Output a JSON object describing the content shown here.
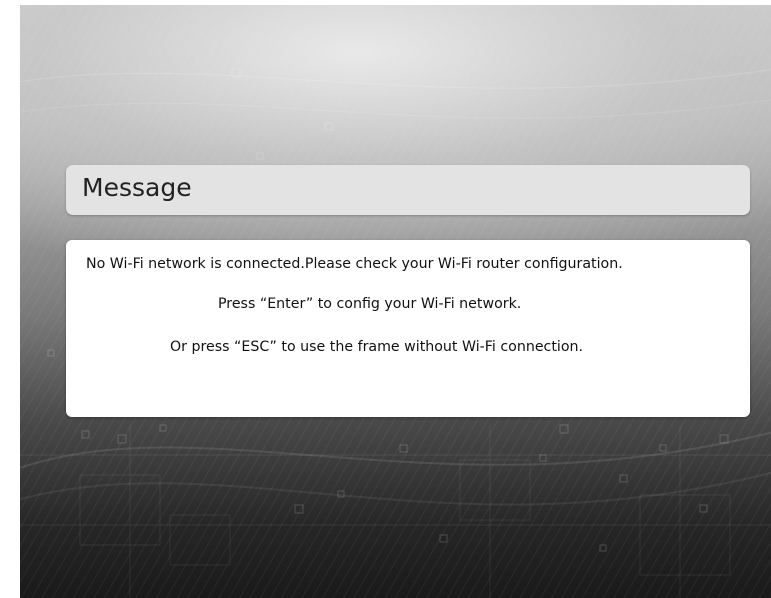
{
  "dialog": {
    "title": "Message",
    "lines": [
      "No Wi-Fi network is connected.Please check your Wi-Fi router configuration.",
      "Press “Enter” to config your Wi-Fi network.",
      "Or press “ESC”  to use the frame without Wi-Fi connection."
    ]
  },
  "colors": {
    "title_bar_bg": "#e3e3e3",
    "message_box_bg": "#ffffff",
    "text": "#111111"
  }
}
